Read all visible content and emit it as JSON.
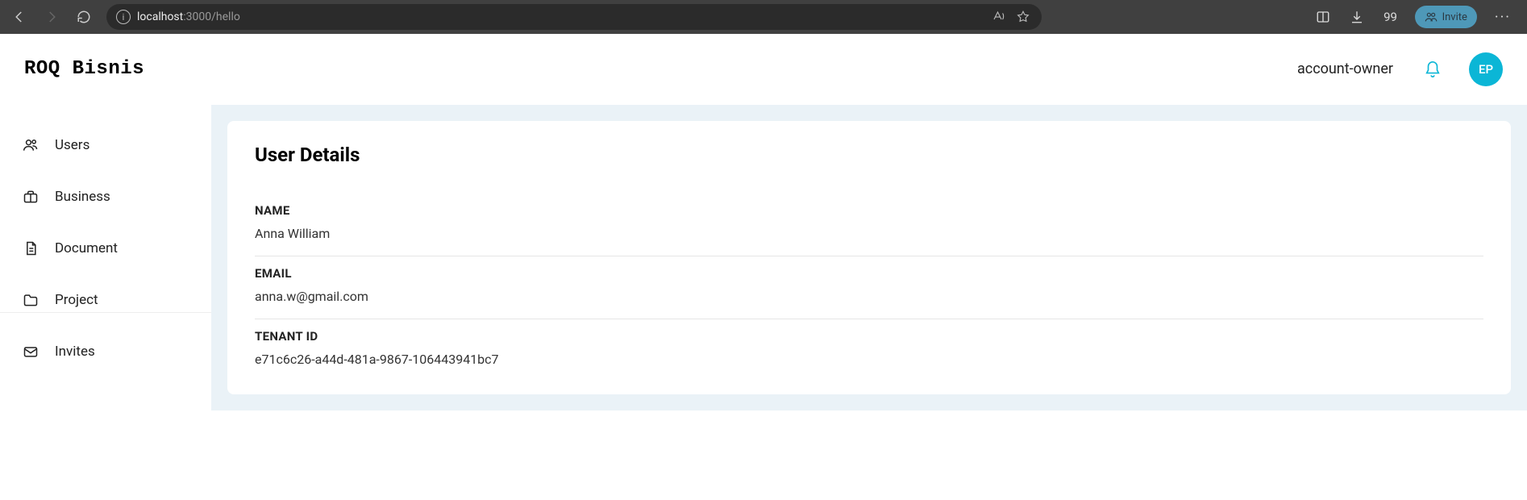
{
  "browser": {
    "url_host": "localhost",
    "url_port": ":3000",
    "url_path": "/hello",
    "quote_badge": "99",
    "invite_label": "Invite"
  },
  "header": {
    "brand": "ROQ Bisnis",
    "role": "account-owner",
    "avatar_initials": "EP"
  },
  "sidebar": {
    "items": [
      {
        "label": "Users",
        "icon": "users-icon"
      },
      {
        "label": "Business",
        "icon": "briefcase-icon"
      },
      {
        "label": "Document",
        "icon": "document-icon"
      },
      {
        "label": "Project",
        "icon": "folder-icon"
      },
      {
        "label": "Invites",
        "icon": "mail-icon"
      }
    ]
  },
  "main": {
    "title": "User Details",
    "fields": [
      {
        "label": "NAME",
        "value": "Anna William"
      },
      {
        "label": "EMAIL",
        "value": "anna.w@gmail.com"
      },
      {
        "label": "TENANT ID",
        "value": "e71c6c26-a44d-481a-9867-106443941bc7"
      }
    ]
  }
}
